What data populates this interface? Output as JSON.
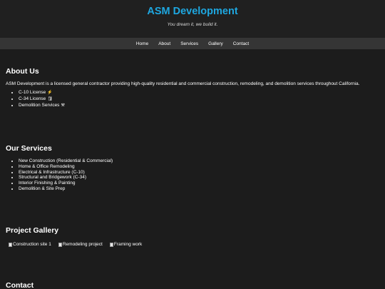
{
  "site": {
    "title": "ASM Development",
    "tagline": "You dream it, we build it.",
    "accent": "#1ea7e0",
    "background": "#1c1c1c"
  },
  "nav": {
    "items": [
      {
        "label": "Home"
      },
      {
        "label": "About"
      },
      {
        "label": "Services"
      },
      {
        "label": "Gallery"
      },
      {
        "label": "Contact"
      }
    ]
  },
  "about": {
    "heading": "About Us",
    "text": "ASM Development is a licensed general contractor providing high-quality residential and commercial construction, remodeling, and demolition services throughout California.",
    "licenses": [
      {
        "label": "C-10 License",
        "icon": "⚡"
      },
      {
        "label": "C-34 License",
        "icon": "🛢"
      },
      {
        "label": "Demolition Services",
        "icon": "⚒"
      }
    ]
  },
  "services": {
    "heading": "Our Services",
    "items": [
      "New Construction (Residential & Commercial)",
      "Home & Office Remodeling",
      "Electrical & Infrastructure (C-10)",
      "Structural and Bridgework (C-34)",
      "Interior Finishing & Painting",
      "Demolition & Site Prep"
    ]
  },
  "gallery": {
    "heading": "Project Gallery",
    "images": [
      {
        "alt": "Construction site 1"
      },
      {
        "alt": "Remodeling project"
      },
      {
        "alt": "Framing work"
      }
    ]
  },
  "contact": {
    "heading": "Contact"
  }
}
